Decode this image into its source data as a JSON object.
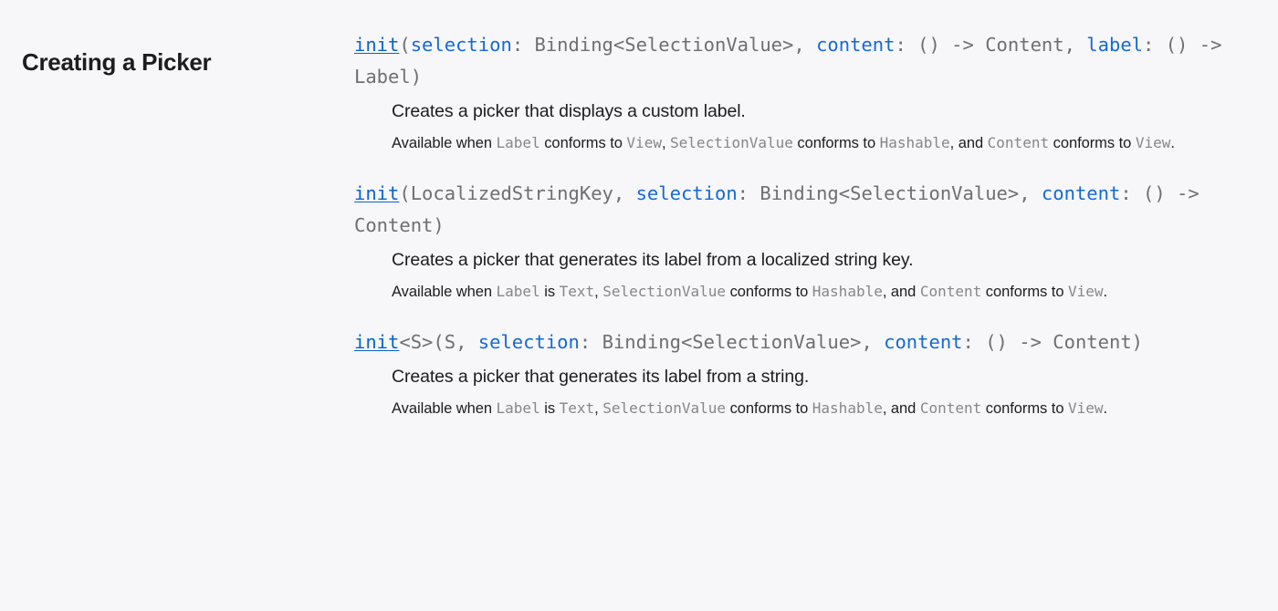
{
  "section": {
    "title": "Creating a Picker"
  },
  "topics": [
    {
      "declaration": {
        "tokens": [
          {
            "t": "init",
            "k": "lnk"
          },
          {
            "t": "(",
            "k": "punct"
          },
          {
            "t": "selection",
            "k": "param"
          },
          {
            "t": ": ",
            "k": "punct"
          },
          {
            "t": "Binding<SelectionValue>",
            "k": "type"
          },
          {
            "t": ", ",
            "k": "punct"
          },
          {
            "t": "content",
            "k": "param"
          },
          {
            "t": ": ",
            "k": "punct"
          },
          {
            "t": "() -> Content",
            "k": "type"
          },
          {
            "t": ", ",
            "k": "punct"
          },
          {
            "t": "label",
            "k": "param"
          },
          {
            "t": ": ",
            "k": "punct"
          },
          {
            "t": "() -> Label)",
            "k": "type"
          }
        ],
        "plain": "init(selection: Binding<SelectionValue>, content: () -> Content, label: () -> Label)"
      },
      "abstract": "Creates a picker that displays a custom label.",
      "availability": [
        {
          "t": "Available when ",
          "k": "text"
        },
        {
          "t": "Label",
          "k": "mono"
        },
        {
          "t": " conforms to ",
          "k": "text"
        },
        {
          "t": "View",
          "k": "mono"
        },
        {
          "t": ", ",
          "k": "text"
        },
        {
          "t": "SelectionValue",
          "k": "mono"
        },
        {
          "t": " conforms to ",
          "k": "text"
        },
        {
          "t": "Hashable",
          "k": "mono"
        },
        {
          "t": ", and ",
          "k": "text"
        },
        {
          "t": "Content",
          "k": "mono"
        },
        {
          "t": " conforms to ",
          "k": "text"
        },
        {
          "t": "View",
          "k": "mono"
        },
        {
          "t": ".",
          "k": "text"
        }
      ]
    },
    {
      "declaration": {
        "tokens": [
          {
            "t": "init",
            "k": "lnk"
          },
          {
            "t": "(",
            "k": "punct"
          },
          {
            "t": "LocalizedStringKey",
            "k": "type"
          },
          {
            "t": ", ",
            "k": "punct"
          },
          {
            "t": "selection",
            "k": "param"
          },
          {
            "t": ": ",
            "k": "punct"
          },
          {
            "t": "Binding<SelectionValue>",
            "k": "type"
          },
          {
            "t": ", ",
            "k": "punct"
          },
          {
            "t": "content",
            "k": "param"
          },
          {
            "t": ": ",
            "k": "punct"
          },
          {
            "t": "() -> Content)",
            "k": "type"
          }
        ],
        "plain": "init(LocalizedStringKey, selection: Binding<SelectionValue>, content: () -> Content)"
      },
      "abstract": "Creates a picker that generates its label from a localized string key.",
      "availability": [
        {
          "t": "Available when ",
          "k": "text"
        },
        {
          "t": "Label",
          "k": "mono"
        },
        {
          "t": " is ",
          "k": "text"
        },
        {
          "t": "Text",
          "k": "mono"
        },
        {
          "t": ", ",
          "k": "text"
        },
        {
          "t": "SelectionValue",
          "k": "mono"
        },
        {
          "t": " conforms to ",
          "k": "text"
        },
        {
          "t": "Hashable",
          "k": "mono"
        },
        {
          "t": ", and ",
          "k": "text"
        },
        {
          "t": "Content",
          "k": "mono"
        },
        {
          "t": " conforms to ",
          "k": "text"
        },
        {
          "t": "View",
          "k": "mono"
        },
        {
          "t": ".",
          "k": "text"
        }
      ]
    },
    {
      "declaration": {
        "tokens": [
          {
            "t": "init",
            "k": "lnk"
          },
          {
            "t": "<S>(S, ",
            "k": "punct"
          },
          {
            "t": "selection",
            "k": "param"
          },
          {
            "t": ": ",
            "k": "punct"
          },
          {
            "t": "Binding<SelectionValue>",
            "k": "type"
          },
          {
            "t": ", ",
            "k": "punct"
          },
          {
            "t": "content",
            "k": "param"
          },
          {
            "t": ": ",
            "k": "punct"
          },
          {
            "t": "() -> Content)",
            "k": "type"
          }
        ],
        "plain": "init<S>(S, selection: Binding<SelectionValue>, content: () -> Content)"
      },
      "abstract": "Creates a picker that generates its label from a string.",
      "availability": [
        {
          "t": "Available when ",
          "k": "text"
        },
        {
          "t": "Label",
          "k": "mono"
        },
        {
          "t": " is ",
          "k": "text"
        },
        {
          "t": "Text",
          "k": "mono"
        },
        {
          "t": ", ",
          "k": "text"
        },
        {
          "t": "SelectionValue",
          "k": "mono"
        },
        {
          "t": " conforms to ",
          "k": "text"
        },
        {
          "t": "Hashable",
          "k": "mono"
        },
        {
          "t": ", and ",
          "k": "text"
        },
        {
          "t": "Content",
          "k": "mono"
        },
        {
          "t": " conforms to ",
          "k": "text"
        },
        {
          "t": "View",
          "k": "mono"
        },
        {
          "t": ".",
          "k": "text"
        }
      ]
    }
  ],
  "colors": {
    "background": "#f7f7f9",
    "link": "#0b63ce",
    "param": "#1569d4",
    "type": "#6e6e73",
    "text": "#1d1d1f",
    "mono_gray": "#86868b"
  }
}
